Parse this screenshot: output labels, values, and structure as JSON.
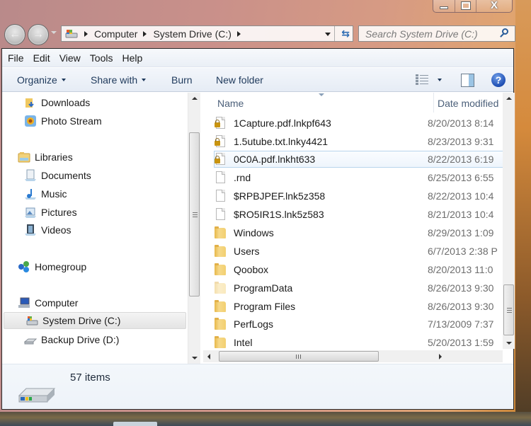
{
  "window": {
    "caption_buttons": {
      "minimize": "minimize",
      "maximize": "maximize",
      "close": "close"
    },
    "close_glyph": "X",
    "maximize_glyph": "",
    "minimize_glyph": ""
  },
  "navigation": {
    "back_icon": "back-arrow-icon",
    "forward_icon": "forward-arrow-icon",
    "back_glyph": "←",
    "forward_glyph": "→"
  },
  "address_bar": {
    "breadcrumbs": [
      "Computer",
      "System Drive (C:)"
    ],
    "refresh_glyph": "⇆"
  },
  "search": {
    "placeholder": "Search System Drive (C:)"
  },
  "menubar": {
    "items": [
      "File",
      "Edit",
      "View",
      "Tools",
      "Help"
    ]
  },
  "toolbar": {
    "organize": "Organize",
    "share_with": "Share with",
    "burn": "Burn",
    "new_folder": "New folder",
    "help_glyph": "?"
  },
  "nav_pane": {
    "items": [
      {
        "label": "Downloads",
        "icon": "downloads-folder-icon",
        "level": 1
      },
      {
        "label": "Photo Stream",
        "icon": "photo-stream-icon",
        "level": 1
      },
      {
        "label": "Libraries",
        "icon": "libraries-icon",
        "level": 0
      },
      {
        "label": "Documents",
        "icon": "documents-library-icon",
        "level": 1
      },
      {
        "label": "Music",
        "icon": "music-library-icon",
        "level": 1
      },
      {
        "label": "Pictures",
        "icon": "pictures-library-icon",
        "level": 1
      },
      {
        "label": "Videos",
        "icon": "videos-library-icon",
        "level": 1
      },
      {
        "label": "Homegroup",
        "icon": "homegroup-icon",
        "level": 0
      },
      {
        "label": "Computer",
        "icon": "computer-icon",
        "level": 0
      },
      {
        "label": "System Drive (C:)",
        "icon": "system-drive-icon",
        "level": 1,
        "selected": true
      },
      {
        "label": "Backup Drive (D:)",
        "icon": "backup-drive-icon",
        "level": 1
      }
    ]
  },
  "file_list": {
    "columns": [
      "Name",
      "Date modified"
    ],
    "rows": [
      {
        "name": "1Capture.pdf.lnkpf643",
        "date": "8/20/2013 8:14",
        "type": "locked-file"
      },
      {
        "name": "1.5utube.txt.lnky4421",
        "date": "8/23/2013 9:31",
        "type": "locked-file"
      },
      {
        "name": "0C0A.pdf.lnkht633",
        "date": "8/22/2013 6:19",
        "type": "locked-file",
        "hover": true
      },
      {
        "name": ".rnd",
        "date": "6/25/2013 6:55",
        "type": "file"
      },
      {
        "name": "$RPBJPEF.lnk5z358",
        "date": "8/22/2013 10:4",
        "type": "file"
      },
      {
        "name": "$RO5IR1S.lnk5z583",
        "date": "8/21/2013 10:4",
        "type": "file"
      },
      {
        "name": "Windows",
        "date": "8/29/2013 1:09",
        "type": "folder"
      },
      {
        "name": "Users",
        "date": "6/7/2013 2:38 P",
        "type": "folder"
      },
      {
        "name": "Qoobox",
        "date": "8/20/2013 11:0",
        "type": "folder"
      },
      {
        "name": "ProgramData",
        "date": "8/26/2013 9:30",
        "type": "hidden-folder"
      },
      {
        "name": "Program Files",
        "date": "8/26/2013 9:30",
        "type": "folder"
      },
      {
        "name": "PerfLogs",
        "date": "7/13/2009 7:37",
        "type": "folder"
      },
      {
        "name": "Intel",
        "date": "5/20/2013 1:59",
        "type": "folder"
      }
    ]
  },
  "details_pane": {
    "item_count": "57 items"
  }
}
